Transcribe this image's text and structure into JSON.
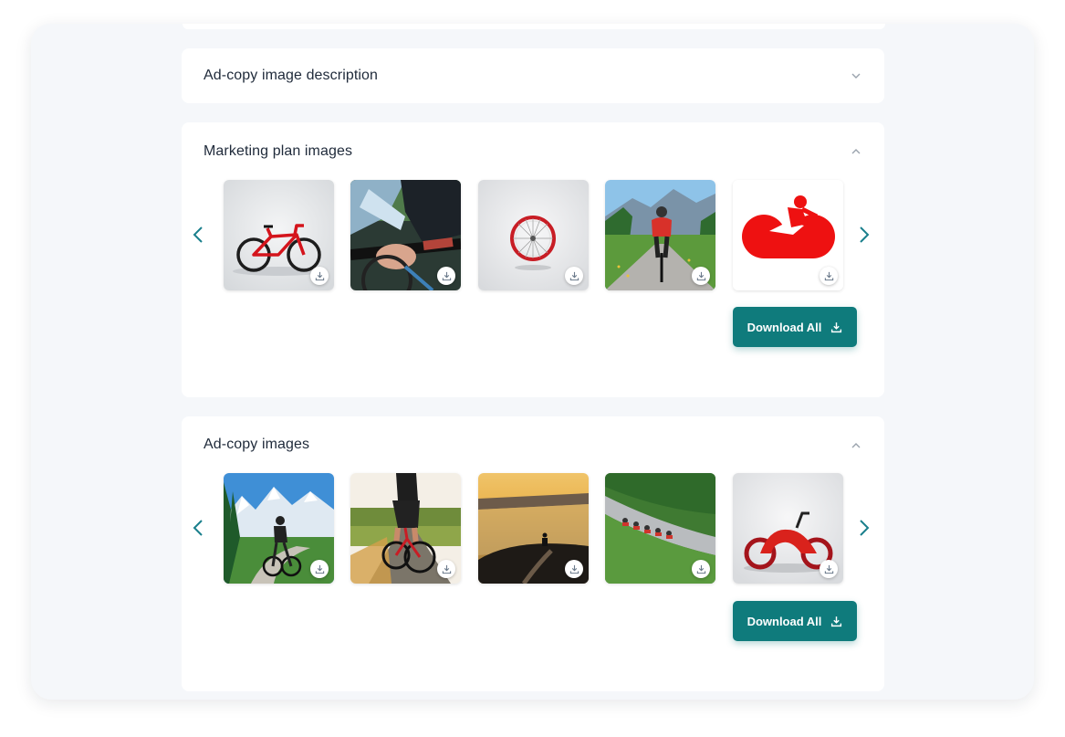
{
  "sections": [
    {
      "title": "Ad-copy image description",
      "state": "collapsed",
      "chevron": "chevron-down-icon"
    },
    {
      "title": "Marketing plan images",
      "state": "expanded",
      "chevron": "chevron-up-icon",
      "images": [
        "road-bike-red",
        "handlebar-closeup",
        "bike-wheel",
        "rider-mountain-road",
        "red-bike-logo"
      ],
      "logo_caption": "",
      "download_all_label": "Download All"
    },
    {
      "title": "Ad-copy images",
      "state": "expanded",
      "chevron": "chevron-up-icon",
      "images": [
        "mountain-trail-rider",
        "vineyard-road-rider",
        "sunset-coast-rider",
        "peloton-road",
        "red-concept-bike"
      ],
      "download_all_label": "Download All"
    }
  ],
  "colors": {
    "accent": "#0f7b7c",
    "arrow": "#1a7f8c",
    "background": "#f5f7fa"
  },
  "icons": {
    "prev": "chevron-left-icon",
    "next": "chevron-right-icon",
    "download": "download-icon"
  }
}
